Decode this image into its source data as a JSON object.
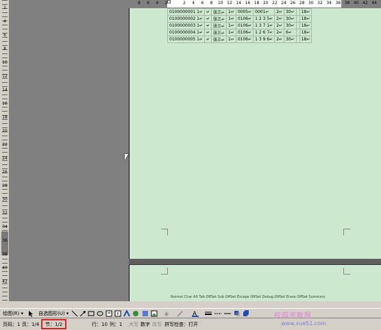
{
  "ruler": {
    "top_numbers": [
      "8",
      "6",
      "4",
      "2",
      "",
      "2",
      "4",
      "6",
      "8",
      "10",
      "12",
      "14",
      "16",
      "18",
      "20",
      "22",
      "24",
      "26",
      "28",
      "30",
      "32",
      "34",
      "36",
      "38",
      "40",
      "42",
      "44",
      "46"
    ],
    "left_numbers": [
      "2",
      "4",
      "6",
      "8",
      "10",
      "12",
      "14",
      "16",
      "18",
      "20",
      "22",
      "24",
      "26",
      "28",
      "30",
      "32",
      "34",
      "36",
      "38",
      "40",
      "42"
    ]
  },
  "table": {
    "rows": [
      [
        "0100000001 1↵",
        "↵",
        "张三↵",
        "1↵",
        "0005↵",
        "0001↵",
        "2↵",
        "30↵",
        "",
        "18↵"
      ],
      [
        "0100000002 1↵",
        "↵",
        "张三↵",
        "1↵",
        "0106↵",
        "1 2 3 5↵",
        "2↵",
        "30↵",
        "",
        "18↵"
      ],
      [
        "0100000003 1↵",
        "↵",
        "张三↵",
        "1↵",
        "0106↵",
        "1 3 7 1↵",
        "2↵",
        "30↵",
        "",
        "18↵"
      ],
      [
        "0100000004 1↵",
        "↵",
        "张三↵",
        "1↵",
        "0106↵",
        "1 2 6 7↵",
        "2↵",
        "6↵",
        "",
        "18↵"
      ],
      [
        "0100000005 1↵",
        "↵",
        "张三↵",
        "1↵",
        "0106↵",
        "1 3 9 6↵",
        "2↵",
        "30↵",
        "",
        "18↵"
      ]
    ]
  },
  "page2": {
    "style_line": "Normal Char Alt Tab OffSet Sub OffSet Escape OffSet Debug OffSet Erase OffSet Summary"
  },
  "drawbar": {
    "draw_label": "绘图(R) ▾",
    "autoshape_label": "自选图形(U) ▾"
  },
  "status": {
    "page_label": "页码：1",
    "page_count": "页：1/4",
    "section": "节：1/2",
    "row": "行：10",
    "col": "列：1",
    "caps": "大写",
    "num": "数字",
    "ovr": "改写",
    "spell": "拼写检查：打开"
  },
  "watermark": {
    "text": "校园学教程",
    "url": "www.xue51.com"
  },
  "colors": {
    "page_bg": "#cce8cf",
    "desk": "#808080",
    "highlight": "#e02020"
  }
}
